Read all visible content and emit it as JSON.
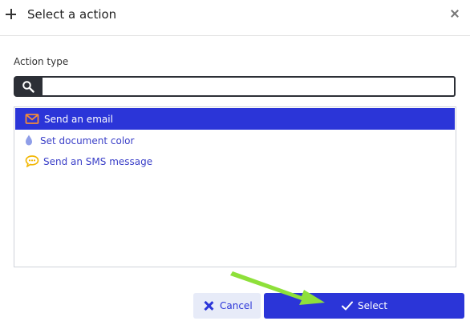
{
  "dialog": {
    "title": "Select a action"
  },
  "field": {
    "label": "Action type",
    "search_value": "",
    "search_placeholder": ""
  },
  "actions": [
    {
      "label": "Send an email",
      "icon": "envelope-icon",
      "selected": true
    },
    {
      "label": "Set document color",
      "icon": "droplet-icon",
      "selected": false
    },
    {
      "label": "Send an SMS message",
      "icon": "chat-bubble-icon",
      "selected": false
    }
  ],
  "buttons": {
    "cancel_label": "Cancel",
    "select_label": "Select"
  },
  "colors": {
    "accent": "#2b35d8",
    "cancel_bg": "#e7ebf8",
    "search_dark": "#2c2f36",
    "envelope_icon": "#f28a3b",
    "droplet_icon": "#8f9ee8",
    "chat_icon": "#f2b705",
    "annotation_arrow": "#8ee03a"
  }
}
